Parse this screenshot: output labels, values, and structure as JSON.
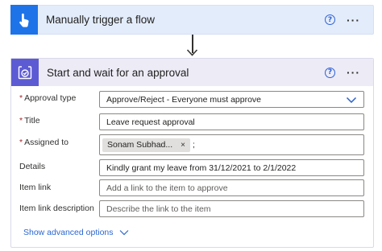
{
  "trigger": {
    "title": "Manually trigger a flow",
    "icon": "touch-hand-icon",
    "accent": "#1e73e8",
    "help": "?",
    "more": "···"
  },
  "approval": {
    "title": "Start and wait for an approval",
    "icon": "approval-check-icon",
    "accent": "#5d5bd4",
    "help": "?",
    "more": "···",
    "fields": {
      "approval_type": {
        "label": "Approval type",
        "required": "*",
        "value": "Approve/Reject - Everyone must approve"
      },
      "title": {
        "label": "Title",
        "required": "*",
        "value": "Leave request approval"
      },
      "assigned_to": {
        "label": "Assigned to",
        "required": "*",
        "token": "Sonam Subhad...",
        "token_remove": "×",
        "separator": ";"
      },
      "details": {
        "label": "Details",
        "value": "Kindly grant my leave from 31/12/2021 to 2/1/2022"
      },
      "item_link": {
        "label": "Item link",
        "placeholder": "Add a link to the item to approve"
      },
      "item_link_description": {
        "label": "Item link description",
        "placeholder": "Describe the link to the item"
      }
    },
    "advanced_options": "Show advanced options"
  }
}
